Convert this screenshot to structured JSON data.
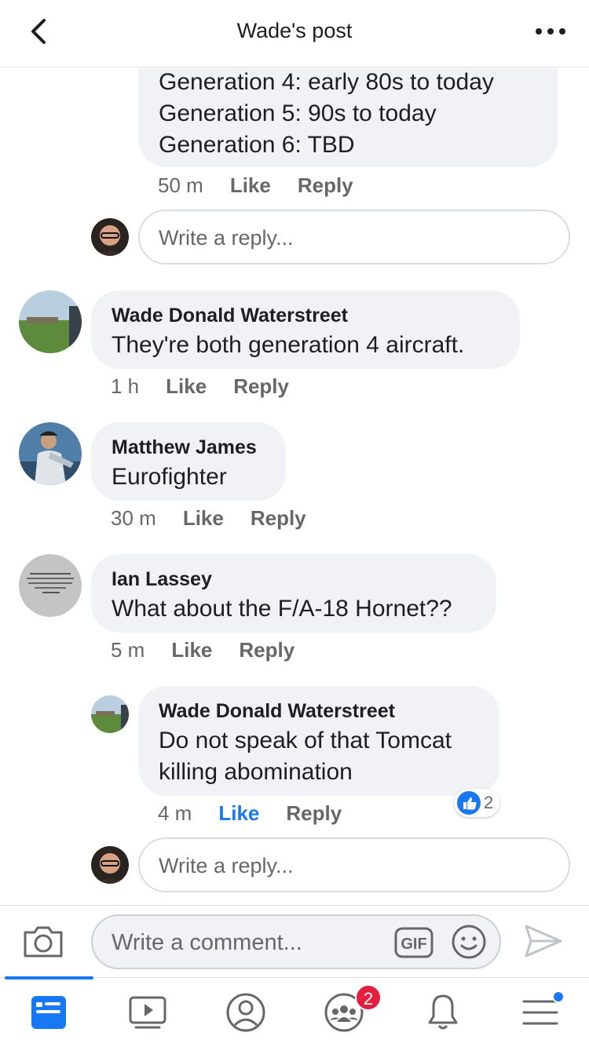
{
  "header": {
    "title": "Wade's post"
  },
  "top_comment": {
    "lines": [
      "Generation 4: early 80s to today",
      "Generation 5: 90s to today",
      "Generation 6: TBD"
    ],
    "time": "50 m",
    "like": "Like",
    "reply": "Reply"
  },
  "reply_placeholder": "Write a reply...",
  "comments": [
    {
      "name": "Wade Donald Waterstreet",
      "text": "They're both generation 4 aircraft.",
      "time": "1 h",
      "like": "Like",
      "reply": "Reply"
    },
    {
      "name": "Matthew James",
      "text": "Eurofighter",
      "time": "30 m",
      "like": "Like",
      "reply": "Reply"
    },
    {
      "name": "Ian Lassey",
      "text": "What about the F/A-18 Hornet??",
      "time": "5 m",
      "like": "Like",
      "reply": "Reply"
    }
  ],
  "nested_reply": {
    "name": "Wade Donald Waterstreet",
    "lines": [
      "Do not speak of that Tomcat",
      "killing abomination"
    ],
    "time": "4 m",
    "like": "Like",
    "reply": "Reply",
    "reaction_count": "2"
  },
  "composer": {
    "placeholder": "Write a comment...",
    "gif_label": "GIF"
  },
  "tabbar": {
    "groups_badge": "2"
  },
  "colors": {
    "accent": "#1877f2",
    "bubble": "#f0f2f5",
    "badge": "#e41e3f"
  }
}
